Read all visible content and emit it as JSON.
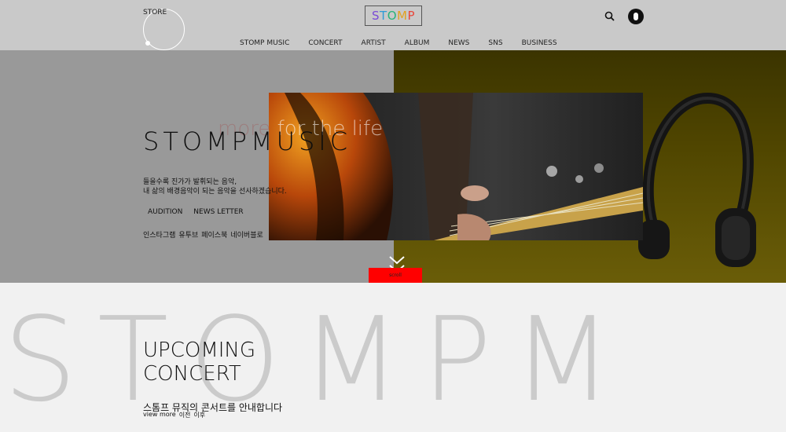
{
  "header": {
    "store_label": "STORE",
    "logo_letters": [
      {
        "ch": "S",
        "color": "#7a4bd6"
      },
      {
        "ch": "T",
        "color": "#2e9bd6"
      },
      {
        "ch": "O",
        "color": "#26b37a"
      },
      {
        "ch": "M",
        "color": "#e3a21f"
      },
      {
        "ch": "P",
        "color": "#e8473b"
      }
    ],
    "nav": [
      "STOMP MUSIC",
      "CONCERT",
      "ARTIST",
      "ALBUM",
      "NEWS",
      "SNS",
      "BUSINESS"
    ]
  },
  "hero": {
    "tagline_dim": "more",
    "tagline": "for the life",
    "title": "STOMPMUSIC",
    "desc_line1": "들을수록 진가가 발휘되는 음악,",
    "desc_line2": "내 삶의 배경음악이 되는 음악을 선사하겠습니다.",
    "links": [
      "AUDITION",
      "NEWS LETTER"
    ],
    "social": [
      "인스타그램",
      "유투브",
      "페이스북",
      "네이버블로"
    ],
    "scroll_label": "scroll"
  },
  "concert": {
    "bg_word": "STOMPM",
    "heading_line1": "UPCOMING",
    "heading_line2": "CONCERT",
    "desc": "스톰프 뮤직의 콘서트를 안내합니다",
    "more_links": [
      "view more",
      "이전",
      "이후"
    ]
  },
  "colors": {
    "header_bg": "#c9c9c9",
    "hero_left_bg": "#999999",
    "hero_right_bg": "#4f4500",
    "scroll_btn": "#ff0000",
    "bg_word": "#cbcbcb"
  }
}
